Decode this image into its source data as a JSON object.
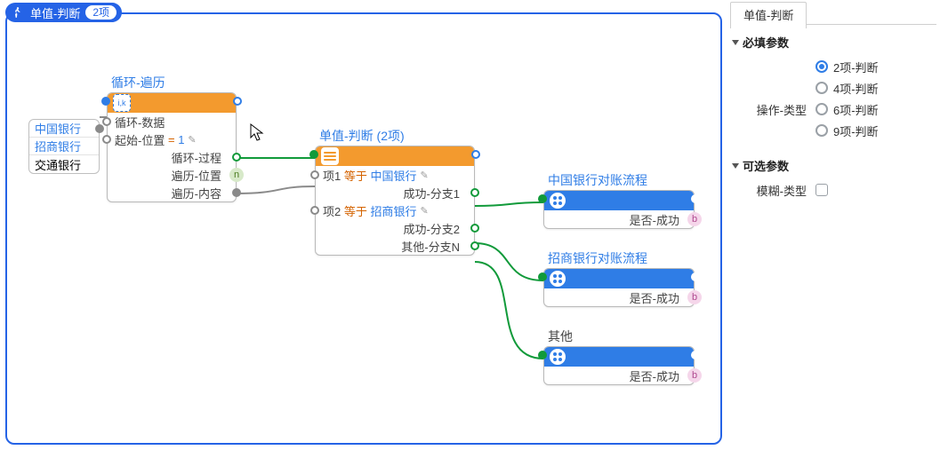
{
  "header": {
    "title": "单值-判断",
    "badge": "2项"
  },
  "listNode": {
    "items": [
      "中国银行",
      "招商银行",
      "交通银行"
    ]
  },
  "loopNode": {
    "title": "循环-遍历",
    "icon": "i,k",
    "rows": {
      "data": "循环-数据",
      "start_label": "起始-位置",
      "start_eq": "=",
      "start_val": "1",
      "process": "循环-过程",
      "pos": "遍历-位置",
      "content": "遍历-内容"
    }
  },
  "switchNode": {
    "title": "单值-判断 (2项)",
    "rows": {
      "item1_label": "项1",
      "item1_op": "等于",
      "item1_val": "中国银行",
      "branch1": "成功-分支1",
      "item2_label": "项2",
      "item2_op": "等于",
      "item2_val": "招商银行",
      "branch2": "成功-分支2",
      "other": "其他-分支N"
    }
  },
  "flowNodes": {
    "f1": {
      "title": "中国银行对账流程",
      "row": "是否-成功"
    },
    "f2": {
      "title": "招商银行对账流程",
      "row": "是否-成功"
    },
    "f3": {
      "title": "其他",
      "row": "是否-成功"
    }
  },
  "sidebar": {
    "tab": "单值-判断",
    "required": "必填参数",
    "operation_type": "操作-类型",
    "opts": {
      "o1": "2项-判断",
      "o2": "4项-判断",
      "o3": "6项-判断",
      "o4": "9项-判断"
    },
    "optional": "可选参数",
    "fuzzy": "模糊-类型"
  }
}
